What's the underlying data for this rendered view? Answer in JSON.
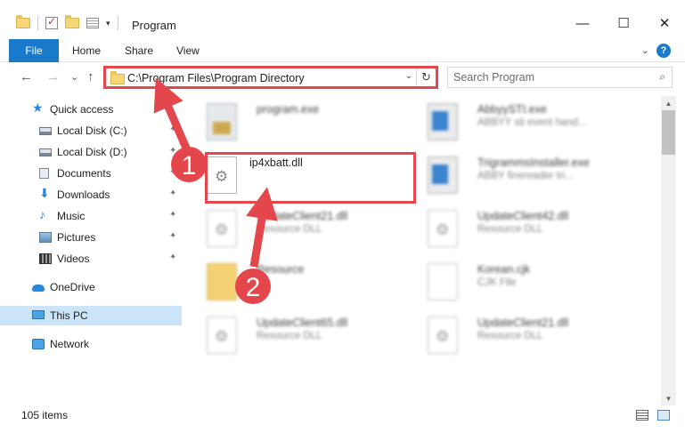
{
  "window": {
    "title": "Program",
    "minimize_glyph": "—",
    "maximize_glyph": "☐",
    "close_glyph": "✕"
  },
  "ribbon": {
    "file": "File",
    "home": "Home",
    "share": "Share",
    "view": "View",
    "help_glyph": "?",
    "expand_glyph": "⌄"
  },
  "nav": {
    "back_glyph": "←",
    "forward_glyph": "→",
    "recent_glyph": "⌄",
    "up_glyph": "↑",
    "address": "C:\\Program Files\\Program Directory",
    "address_drop_glyph": "⌄",
    "refresh_glyph": "↻",
    "search_placeholder": "Search Program",
    "search_glyph": "⌕"
  },
  "sidebar": {
    "items": [
      {
        "label": "Quick access"
      },
      {
        "label": "Local Disk (C:)"
      },
      {
        "label": "Local Disk (D:)"
      },
      {
        "label": "Documents"
      },
      {
        "label": "Downloads"
      },
      {
        "label": "Music"
      },
      {
        "label": "Pictures"
      },
      {
        "label": "Videos"
      },
      {
        "label": "OneDrive"
      },
      {
        "label": "This PC"
      },
      {
        "label": "Network"
      }
    ],
    "pin_glyph": "✦"
  },
  "files": [
    {
      "name": "program.exe",
      "desc": ""
    },
    {
      "name": "AbbyySTI.exe",
      "desc": "ABBYY sti event hand..."
    },
    {
      "name": "ip4xbatt.dll",
      "desc": ""
    },
    {
      "name": "TrigrammsInstaller.exe",
      "desc": "ABBY finereader tri..."
    },
    {
      "name": "UpdateClient21.dll",
      "desc": "Resource DLL"
    },
    {
      "name": "UpdateClient42.dll",
      "desc": "Resource DLL"
    },
    {
      "name": "Resource",
      "desc": ""
    },
    {
      "name": "Korean.cjk",
      "desc": "CJK File"
    },
    {
      "name": "UpdateClient65.dll",
      "desc": "Resource DLL"
    },
    {
      "name": "UpdateClient21.dll",
      "desc": "Resource DLL"
    }
  ],
  "status": {
    "item_count": "105 items"
  },
  "scroll": {
    "up_glyph": "▲",
    "down_glyph": "▼"
  },
  "annotations": {
    "step1": "1",
    "step2": "2",
    "color": "#e3464b"
  }
}
